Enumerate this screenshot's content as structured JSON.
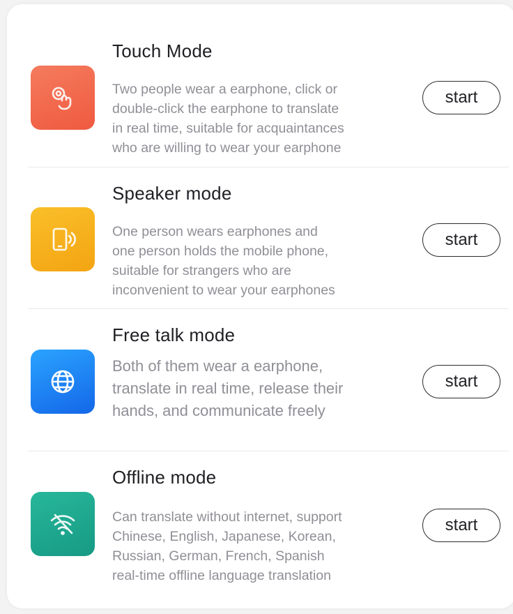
{
  "modes": [
    {
      "title": "Touch Mode",
      "description_lines": [
        "Two people wear a earphone, click or",
        "double-click the earphone to translate",
        "in real time, suitable for acquaintances",
        "who are willing to wear your earphone"
      ],
      "button_label": "start",
      "icon": "touch-gesture-icon",
      "icon_color": "#f46a4f"
    },
    {
      "title": "Speaker mode",
      "description_lines": [
        "One person wears earphones and",
        "one person holds the mobile phone,",
        "suitable for strangers who are",
        "inconvenient to wear your earphones"
      ],
      "button_label": "start",
      "icon": "phone-speaker-icon",
      "icon_color": "#f7b21c"
    },
    {
      "title": "Free talk mode",
      "description_lines": [
        "Both of them wear a earphone,",
        "translate in real time, release their",
        "hands, and communicate freely"
      ],
      "button_label": "start",
      "icon": "globe-icon",
      "icon_color": "#1a7df0"
    },
    {
      "title": "Offline mode",
      "description_lines": [
        "Can translate without internet, support",
        "Chinese, English, Japanese, Korean,",
        "Russian, German, French, Spanish",
        "real-time offline language translation"
      ],
      "button_label": "start",
      "icon": "wifi-off-icon",
      "icon_color": "#1fa88f"
    }
  ]
}
